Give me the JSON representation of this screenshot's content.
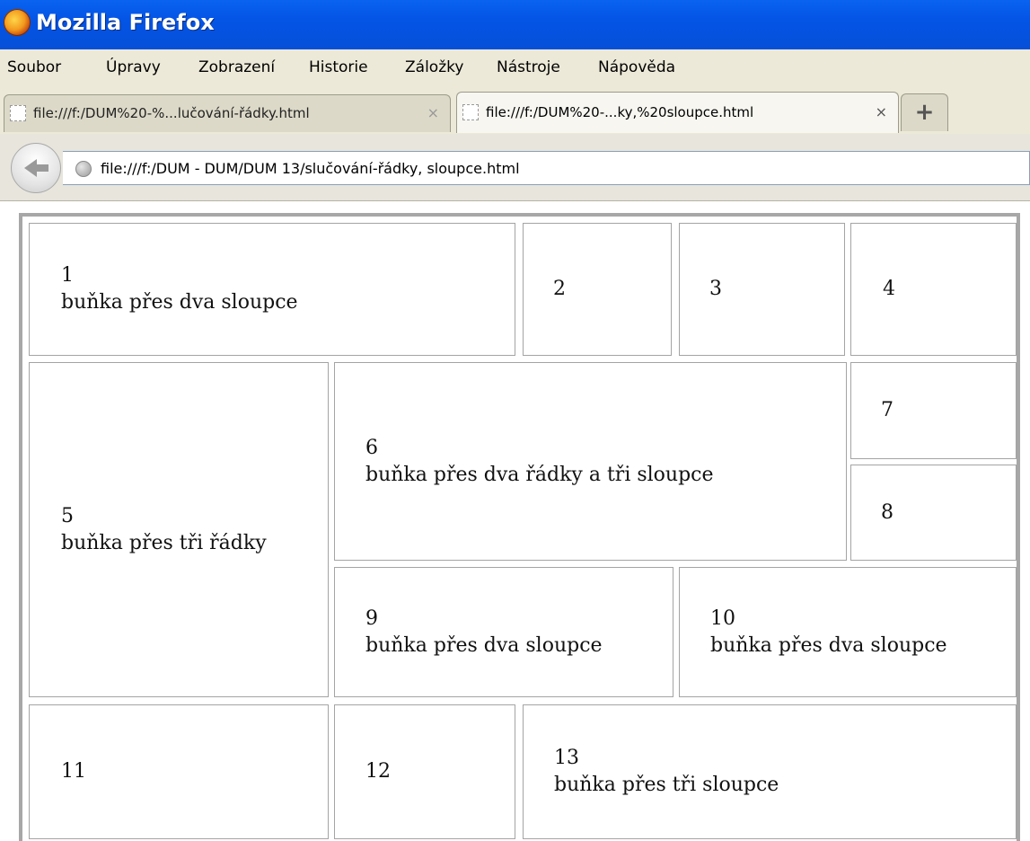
{
  "window": {
    "title": "Mozilla Firefox"
  },
  "menu": {
    "items": [
      "Soubor",
      "Úpravy",
      "Zobrazení",
      "Historie",
      "Záložky",
      "Nástroje",
      "Nápověda"
    ]
  },
  "tabs": [
    {
      "title": "file:///f:/DUM%20-%...lučování-řádky.html",
      "close": "×",
      "active": false
    },
    {
      "title": "file:///f:/DUM%20-...ky,%20sloupce.html",
      "close": "×",
      "active": true
    }
  ],
  "new_tab_label": "+",
  "navigation": {
    "url": "file:///f:/DUM - DUM/DUM 13/slučování-řádky, sloupce.html"
  },
  "table": {
    "cells": {
      "c1": {
        "num": "1",
        "text": "buňka přes dva sloupce"
      },
      "c2": {
        "num": "2"
      },
      "c3": {
        "num": "3"
      },
      "c4": {
        "num": "4"
      },
      "c5": {
        "num": "5",
        "text": "buňka přes tři řádky"
      },
      "c6": {
        "num": "6",
        "text": "buňka přes dva řádky a tři sloupce"
      },
      "c7": {
        "num": "7"
      },
      "c8": {
        "num": "8"
      },
      "c9": {
        "num": "9",
        "text": "buňka přes dva sloupce"
      },
      "c10": {
        "num": "10",
        "text": "buňka přes dva sloupce"
      },
      "c11": {
        "num": "11"
      },
      "c12": {
        "num": "12"
      },
      "c13": {
        "num": "13",
        "text": "buňka přes tři sloupce"
      }
    }
  }
}
